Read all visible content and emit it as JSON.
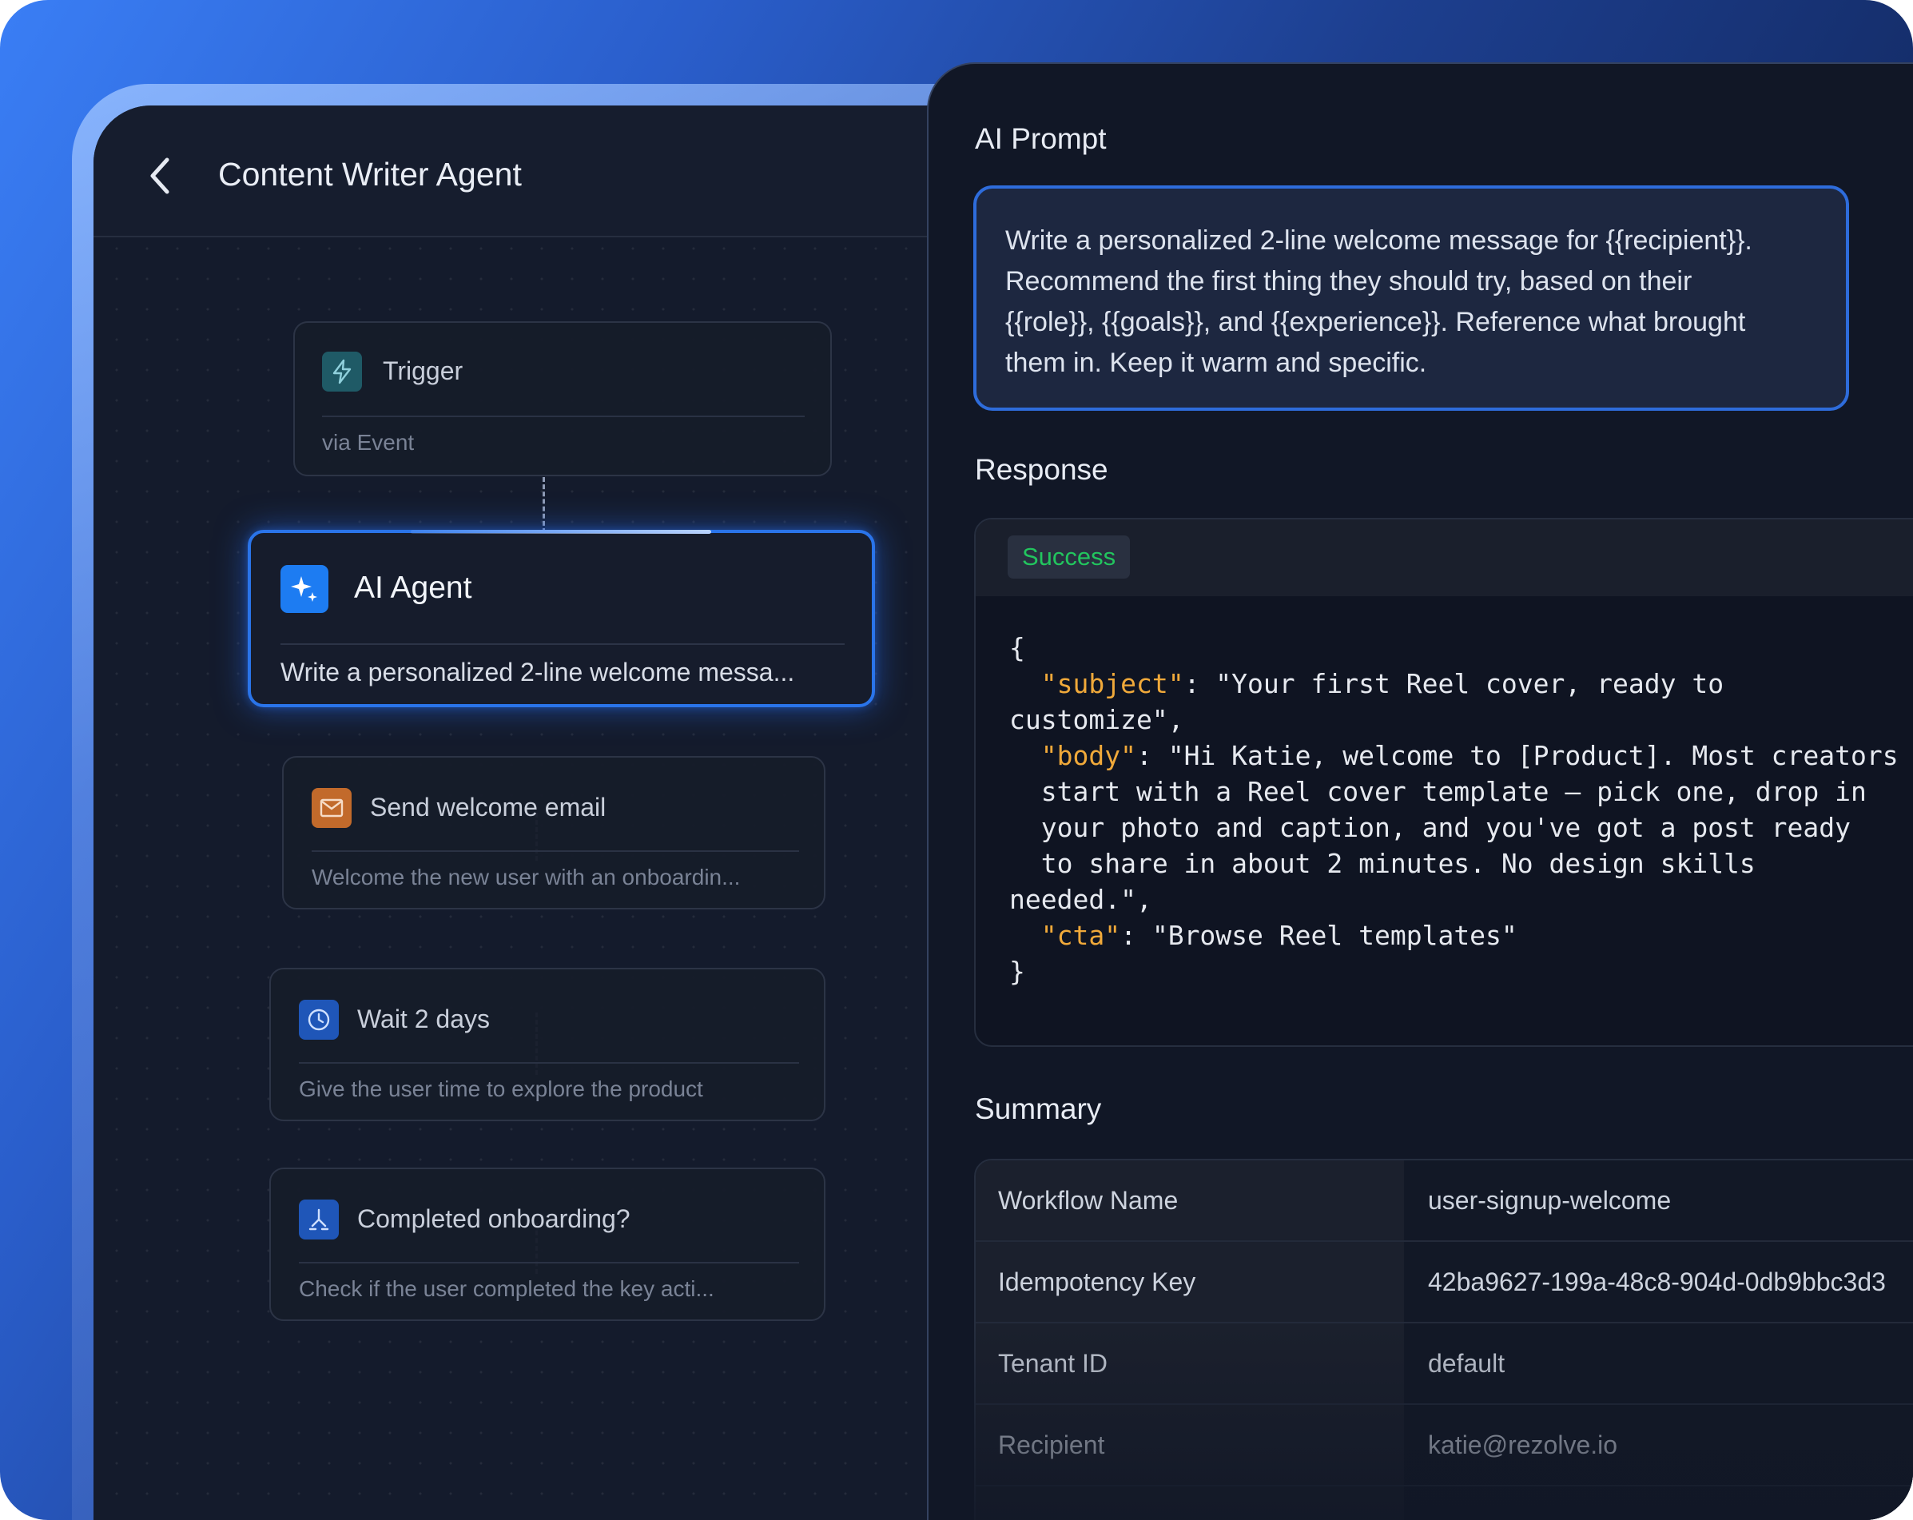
{
  "agent": {
    "title": "Content Writer Agent"
  },
  "workflow": {
    "trigger": {
      "title": "Trigger",
      "desc": "via Event"
    },
    "ai_agent": {
      "title": "AI Agent",
      "desc": "Write a personalized 2-line welcome messa..."
    },
    "send_email": {
      "title": "Send welcome email",
      "desc": "Welcome the new user with an onboardin..."
    },
    "wait": {
      "title": "Wait 2 days",
      "desc": "Give the user time to explore the product"
    },
    "completed": {
      "title": "Completed onboarding?",
      "desc": "Check if the user completed the key acti..."
    }
  },
  "prompt": {
    "heading": "AI Prompt",
    "lines": [
      "Write a personalized 2-line welcome message for {{recipient}}.",
      "Recommend the first thing they should try, based on their",
      "{{role}}, {{goals}}, and {{experience}}. Reference what brought",
      "them in. Keep it warm and specific."
    ]
  },
  "response": {
    "heading": "Response",
    "status": "Success",
    "json": {
      "open_brace": "{",
      "subject_key": "\"subject\"",
      "subject_val_1": ": \"Your first Reel cover, ready to",
      "subject_val_2": "customize\",",
      "body_key": "\"body\"",
      "body_val_1": ": \"Hi Katie, welcome to [Product]. Most creators",
      "body_val_2": "start with a Reel cover template — pick one, drop in",
      "body_val_3": "your photo and caption, and you've got a post ready",
      "body_val_4": "to share in about 2 minutes. No design skills",
      "body_val_5": "needed.\",",
      "cta_key": "\"cta\"",
      "cta_val": ": \"Browse Reel templates\"",
      "close_brace": "}"
    }
  },
  "summary": {
    "heading": "Summary",
    "rows": [
      {
        "key": "Workflow Name",
        "value": "user-signup-welcome"
      },
      {
        "key": "Idempotency Key",
        "value": "42ba9627-199a-48c8-904d-0db9bbc3d3"
      },
      {
        "key": "Tenant ID",
        "value": "default"
      },
      {
        "key": "Recipient",
        "value": "katie@rezolve.io"
      }
    ]
  },
  "colors": {
    "accent_blue": "#2a74ea",
    "success_green": "#22c55e",
    "json_key_orange": "#f0a93a",
    "trigger_icon_bg": "#1f5a66",
    "email_icon_bg": "#c26a2b",
    "wait_icon_bg": "#1f56b8",
    "branch_icon_bg": "#1f56b8"
  },
  "icons": [
    "chevron-left-icon",
    "lightning-icon",
    "sparkle-icon",
    "mail-icon",
    "clock-icon",
    "branch-icon"
  ]
}
